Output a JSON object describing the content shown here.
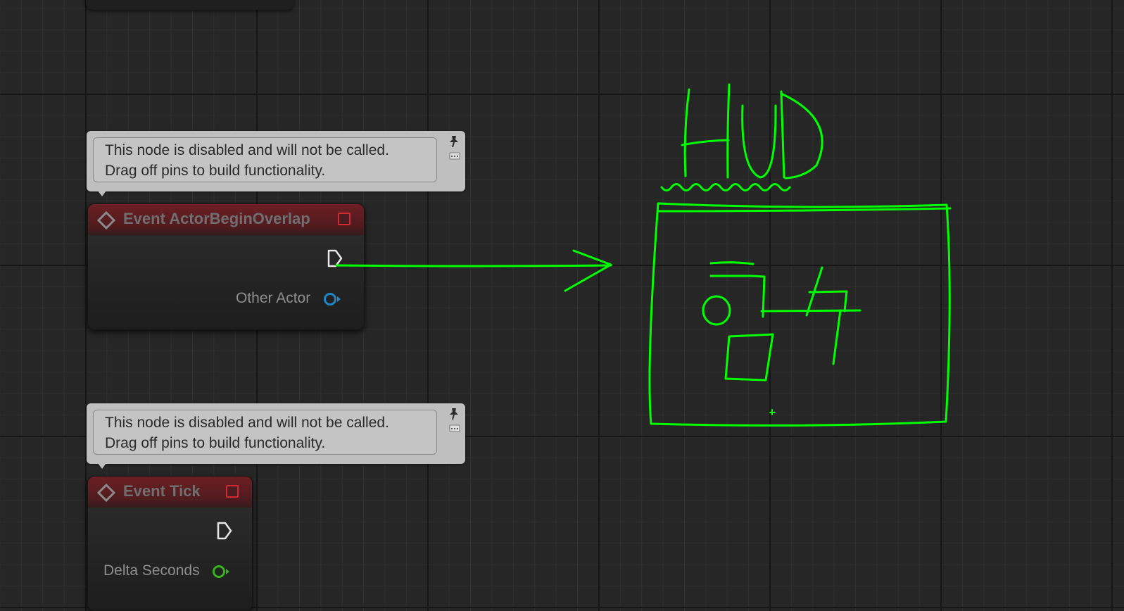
{
  "comments": [
    {
      "line1": "This node is disabled and will not be called.",
      "line2": "Drag off pins to build functionality."
    },
    {
      "line1": "This node is disabled and will not be called.",
      "line2": "Drag off pins to build functionality."
    }
  ],
  "nodes": [
    {
      "title": "Event ActorBeginOverlap",
      "pin_label": "Other Actor",
      "pin_color": "#1e88c7"
    },
    {
      "title": "Event Tick",
      "pin_label": "Delta Seconds",
      "pin_color": "#35b519"
    }
  ],
  "drawing": {
    "label": "HUD",
    "color": "#00ff00"
  },
  "colors": {
    "canvas": "#262626",
    "node_header": "#7a1f24",
    "close_button": "#d12a32"
  }
}
